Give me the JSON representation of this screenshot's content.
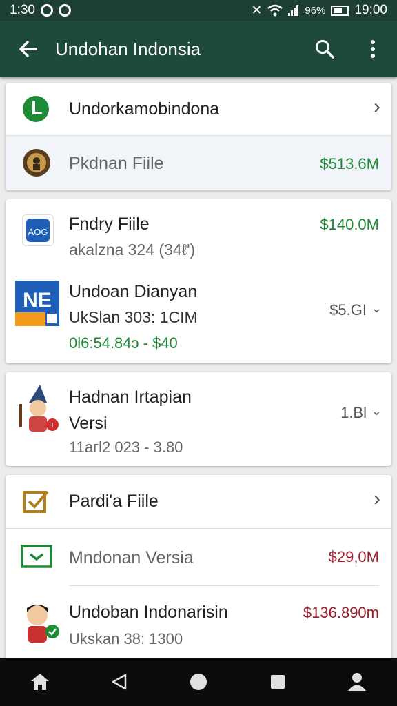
{
  "status_bar": {
    "time_left": "1:30",
    "battery_pct": "96%",
    "clock": "19:00"
  },
  "app_bar": {
    "back_icon": "back-arrow-icon",
    "title": "Undohan Indonsia",
    "search_icon": "search-icon",
    "menu_icon": "more-vert-icon"
  },
  "card1": {
    "header_label": "Undorkamobindona",
    "item": {
      "label": "Pkdnan Fiile",
      "value": "$513.6M"
    }
  },
  "card2": {
    "items": [
      {
        "title": "Fndry Fiile",
        "subtitle": "akalzna 324 (34ℓ')",
        "value": "$140.0M"
      },
      {
        "title": "Undoan Dianyan",
        "subtitle": "UkSlan 303: 1CIM",
        "detail": "0l6:54.84ɔ - $40",
        "value": "$5.GI"
      }
    ]
  },
  "card3": {
    "title_line1": "Hadnan Irtapian",
    "title_line2": "Versi",
    "subtitle": "11агl2 023 - 3.80",
    "value": "1.Bl"
  },
  "card4": {
    "header_label": "Pardi'a Fiile",
    "items": [
      {
        "label": "Mndonan Versia",
        "value": "$29,0M"
      },
      {
        "title": "Undoban Indonarisin",
        "subtitle": "Ukskan 38: 1300",
        "value": "$136.890m"
      }
    ]
  },
  "colors": {
    "app_bar": "#1e4a3c",
    "positive": "#1e8a36",
    "negative": "#9c1c2a"
  },
  "nav": {
    "home": "home-icon",
    "back": "nav-back-icon",
    "circle": "nav-home-circle-icon",
    "square": "recents-icon",
    "person": "profile-icon"
  }
}
